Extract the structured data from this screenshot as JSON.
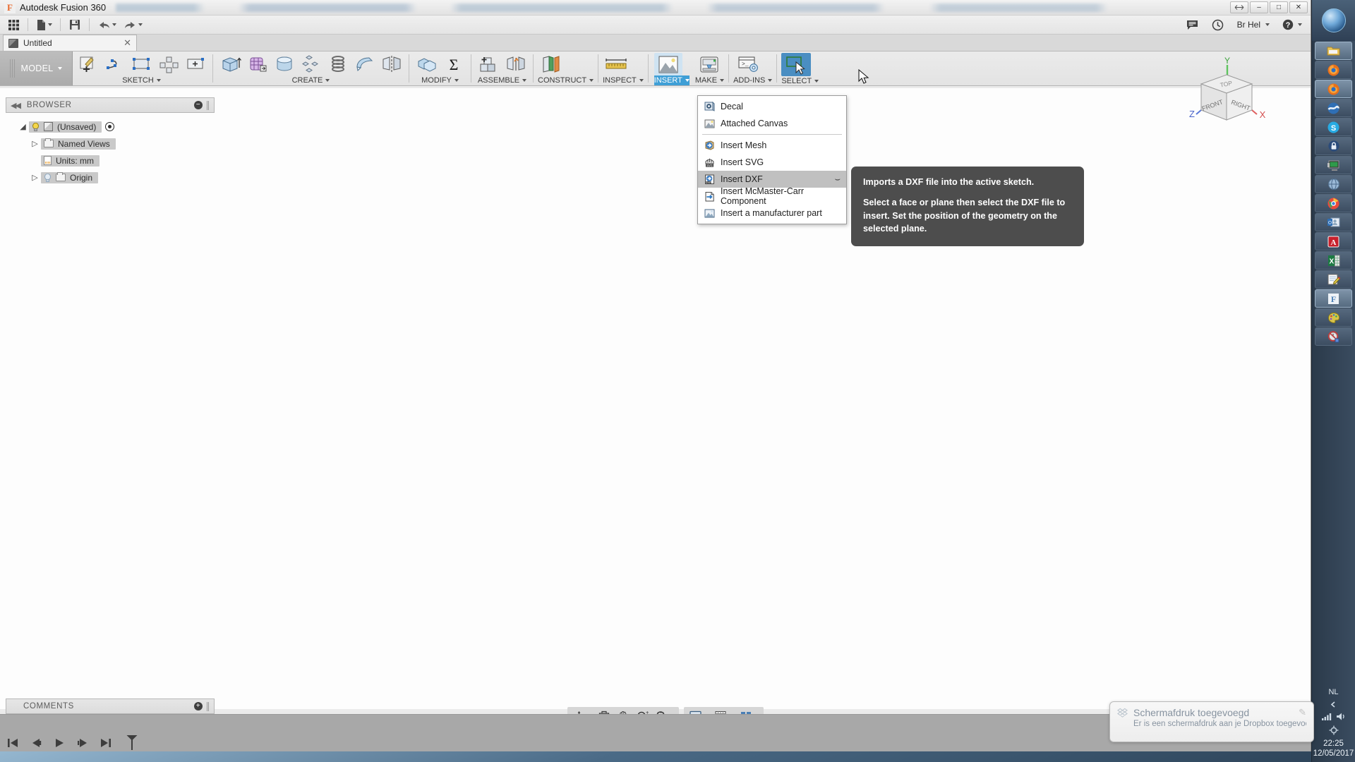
{
  "window": {
    "app_title": "Autodesk Fusion 360",
    "logo_letter": "F",
    "minimize": "–",
    "maximize": "□",
    "close": "✕"
  },
  "quick_access": {
    "grid_icon": "grid-icon",
    "new_icon": "new-document-icon",
    "save_icon": "save-icon",
    "undo_icon": "undo-icon",
    "redo_icon": "redo-icon",
    "comment_icon": "comment-icon",
    "history_icon": "history-clock-icon",
    "user_name": "Br Hel",
    "help_icon": "help-icon"
  },
  "document_tab": {
    "name": "Untitled",
    "close": "✕"
  },
  "ribbon": {
    "workspace": "MODEL",
    "groups": [
      {
        "label": "SKETCH",
        "active": false,
        "tools": [
          "create-sketch-icon",
          "spline-icon",
          "rectangle-icon",
          "sketch-pattern-icon",
          "sketch-dimension-icon"
        ]
      },
      {
        "label": "CREATE",
        "active": false,
        "tools": [
          "extrude-icon",
          "revolve-icon",
          "loft-icon",
          "pattern-icon",
          "coil-icon",
          "sweep-icon",
          "mirror-icon"
        ]
      },
      {
        "label": "MODIFY",
        "active": false,
        "tools": [
          "combine-icon",
          "parameters-sigma-icon"
        ]
      },
      {
        "label": "ASSEMBLE",
        "active": false,
        "tools": [
          "new-component-icon",
          "joint-icon"
        ]
      },
      {
        "label": "CONSTRUCT",
        "active": false,
        "tools": [
          "offset-plane-icon"
        ]
      },
      {
        "label": "INSPECT",
        "active": false,
        "tools": [
          "measure-ruler-icon"
        ]
      },
      {
        "label": "INSERT",
        "active": true,
        "tools": [
          "insert-image-icon"
        ]
      },
      {
        "label": "MAKE",
        "active": false,
        "tools": [
          "3d-print-icon"
        ]
      },
      {
        "label": "ADD-INS",
        "active": false,
        "tools": [
          "scripts-addins-icon"
        ]
      },
      {
        "label": "SELECT",
        "active": false,
        "tools": [
          "select-arrow-icon"
        ]
      }
    ]
  },
  "browser": {
    "title": "BROWSER",
    "collapse_icon": "collapse-left-icon",
    "options_icon": "panel-options-icon",
    "tree": [
      {
        "label": "(Unsaved)",
        "icon": "document-cube-icon",
        "bulb": "lightbulb-on-icon",
        "expander": "expanded",
        "extra": "origin-toggle-icon"
      },
      {
        "label": "Named Views",
        "icon": "folder-icon",
        "bulb": "",
        "expander": "collapsed",
        "extra": ""
      },
      {
        "label": "Units: mm",
        "icon": "units-document-icon",
        "bulb": "",
        "expander": "",
        "extra": ""
      },
      {
        "label": "Origin",
        "icon": "folder-icon",
        "bulb": "lightbulb-off-icon",
        "expander": "collapsed",
        "extra": ""
      }
    ]
  },
  "insert_menu": {
    "items": [
      {
        "label": "Decal",
        "icon": "decal-icon",
        "highlighted": false,
        "has_submenu": false,
        "separator_after": false
      },
      {
        "label": "Attached Canvas",
        "icon": "attached-canvas-icon",
        "highlighted": false,
        "has_submenu": false,
        "separator_after": true
      },
      {
        "label": "Insert Mesh",
        "icon": "insert-mesh-icon",
        "highlighted": false,
        "has_submenu": false,
        "separator_after": false
      },
      {
        "label": "Insert SVG",
        "icon": "insert-svg-icon",
        "highlighted": false,
        "has_submenu": false,
        "separator_after": false
      },
      {
        "label": "Insert DXF",
        "icon": "insert-dxf-icon",
        "highlighted": true,
        "has_submenu": true,
        "separator_after": false
      },
      {
        "label": "Insert McMaster-Carr Component",
        "icon": "mcmaster-carr-icon",
        "highlighted": false,
        "has_submenu": false,
        "separator_after": false
      },
      {
        "label": "Insert a manufacturer part",
        "icon": "manufacturer-part-icon",
        "highlighted": false,
        "has_submenu": false,
        "separator_after": false
      }
    ],
    "submenu_glyph": "⌣"
  },
  "tooltip": {
    "title": "Imports a DXF file into the active sketch.",
    "body": "Select a face or plane then select the DXF file to insert. Set the position of the geometry on the selected plane."
  },
  "viewcube": {
    "top_face": "TOP",
    "front_face": "FRONT",
    "right_face": "RIGHT",
    "axis_x": "X",
    "axis_y": "Y",
    "axis_z": "Z"
  },
  "comments": {
    "title": "COMMENTS",
    "add_icon": "add-comment-icon"
  },
  "navigation_bar": {
    "tools": [
      "orbit-icon",
      "look-at-icon",
      "pan-icon",
      "zoom-icon",
      "fit-icon"
    ],
    "display": [
      "display-settings-icon",
      "grid-snap-icon",
      "viewports-icon"
    ]
  },
  "timeline": {
    "controls": [
      "go-to-beginning-icon",
      "step-back-icon",
      "play-icon",
      "step-forward-icon",
      "go-to-end-icon"
    ],
    "marker": "timeline-marker-icon"
  },
  "taskbar": {
    "start": "windows-start-orb",
    "icons": [
      "file-explorer-icon",
      "firefox-icon",
      "firefox-icon",
      "internet-browser-icon",
      "skype-icon",
      "lock-secure-icon",
      "remote-desktop-icon",
      "network-icon",
      "chrome-icon",
      "outlook-icon",
      "adobe-acrobat-icon",
      "excel-icon",
      "notepad-edit-icon",
      "fusion360-icon",
      "paint-palette-icon",
      "disabled-clock-icon"
    ],
    "language": "NL",
    "tray_icons": [
      "show-hidden-icons-icon",
      "network-tray-icon",
      "volume-tray-icon",
      "action-center-icon"
    ],
    "clock_time": "22:25",
    "clock_date": "12/05/2017"
  },
  "toast": {
    "icon": "dropbox-icon",
    "title": "Schermafdruk toegevoegd",
    "message": "Er is een schermafdruk aan je Dropbox toegevoegd.",
    "pin_icon": "pin-icon"
  },
  "colors": {
    "accent_blue": "#3f9fd6",
    "select_blue": "#4a8ec2",
    "tooltip_bg": "#4d4d4d",
    "highlight_gray": "#c0c0c0"
  }
}
